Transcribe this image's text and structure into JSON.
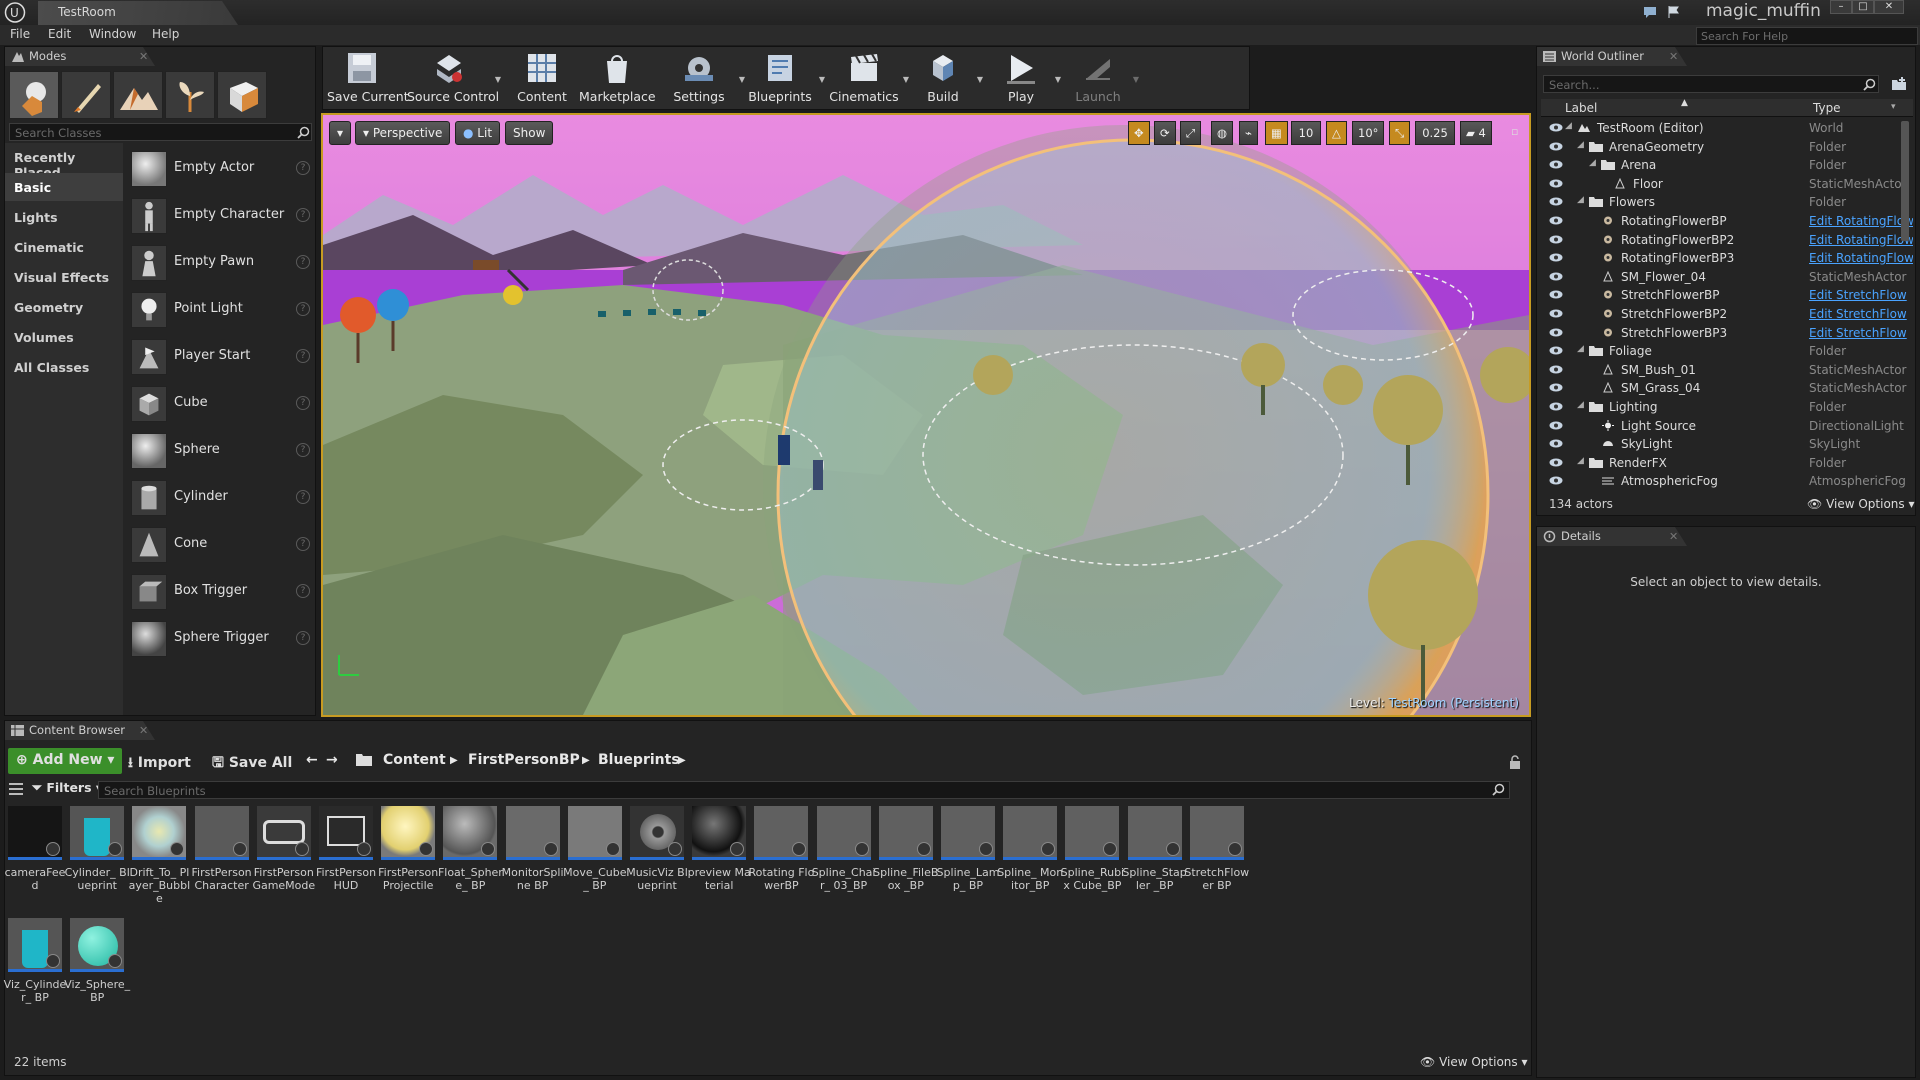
{
  "title_bar": {
    "tab": "TestRoom",
    "user": "magic_muffin"
  },
  "menu": [
    "File",
    "Edit",
    "Window",
    "Help"
  ],
  "help_search": {
    "placeholder": "Search For Help"
  },
  "modes": {
    "tab": "Modes",
    "search_placeholder": "Search Classes",
    "categories": [
      "Recently Placed",
      "Basic",
      "Lights",
      "Cinematic",
      "Visual Effects",
      "Geometry",
      "Volumes",
      "All Classes"
    ],
    "selected_category": "Basic",
    "items": [
      "Empty Actor",
      "Empty Character",
      "Empty Pawn",
      "Point Light",
      "Player Start",
      "Cube",
      "Sphere",
      "Cylinder",
      "Cone",
      "Box Trigger",
      "Sphere Trigger"
    ]
  },
  "toolbar": [
    "Save Current",
    "Source Control",
    "Content",
    "Marketplace",
    "Settings",
    "Blueprints",
    "Cinematics",
    "Build",
    "Play",
    "Launch"
  ],
  "viewport": {
    "perspective": "Perspective",
    "lit": "Lit",
    "show": "Show",
    "grid_snap": "10",
    "rotation_snap": "10°",
    "scale_snap": "0.25",
    "camera_speed": "4",
    "level_label": "Level:",
    "level_name": "TestRoom (Persistent)"
  },
  "outliner": {
    "tab": "World Outliner",
    "search_placeholder": "Search...",
    "col_label": "Label",
    "col_type": "Type",
    "rows": [
      {
        "label": "TestRoom (Editor)",
        "type": "World"
      },
      {
        "label": "ArenaGeometry",
        "type": "Folder"
      },
      {
        "label": "Arena",
        "type": "Folder"
      },
      {
        "label": "Floor",
        "type": "StaticMeshActor"
      },
      {
        "label": "Flowers",
        "type": "Folder"
      },
      {
        "label": "RotatingFlowerBP",
        "type": "Edit RotatingFlow"
      },
      {
        "label": "RotatingFlowerBP2",
        "type": "Edit RotatingFlow"
      },
      {
        "label": "RotatingFlowerBP3",
        "type": "Edit RotatingFlow"
      },
      {
        "label": "SM_Flower_04",
        "type": "StaticMeshActor"
      },
      {
        "label": "StretchFlowerBP",
        "type": "Edit StretchFlow"
      },
      {
        "label": "StretchFlowerBP2",
        "type": "Edit StretchFlow"
      },
      {
        "label": "StretchFlowerBP3",
        "type": "Edit StretchFlow"
      },
      {
        "label": "Foliage",
        "type": "Folder"
      },
      {
        "label": "SM_Bush_01",
        "type": "StaticMeshActor"
      },
      {
        "label": "SM_Grass_04",
        "type": "StaticMeshActor"
      },
      {
        "label": "Lighting",
        "type": "Folder"
      },
      {
        "label": "Light Source",
        "type": "DirectionalLight"
      },
      {
        "label": "SkyLight",
        "type": "SkyLight"
      },
      {
        "label": "RenderFX",
        "type": "Folder"
      },
      {
        "label": "AtmosphericFog",
        "type": "AtmosphericFog"
      }
    ],
    "actor_count": "134 actors",
    "view_options": "View Options"
  },
  "details": {
    "tab": "Details",
    "empty": "Select an object to view details."
  },
  "content_browser": {
    "tab": "Content Browser",
    "add_new": "Add New",
    "import": "Import",
    "save_all": "Save All",
    "path": [
      "Content",
      "FirstPersonBP",
      "Blueprints"
    ],
    "filters": "Filters",
    "search_placeholder": "Search Blueprints",
    "assets": [
      "cameraFeed",
      "Cylinder_ Blueprint",
      "Drift_To_ Player_Bubble",
      "FirstPerson Character",
      "FirstPerson GameMode",
      "FirstPerson HUD",
      "FirstPerson Projectile",
      "Float_Sphere_ BP",
      "MonitorSpline BP",
      "Move_Cube_ BP",
      "MusicViz Blueprint",
      "preview Material",
      "Rotating FlowerBP",
      "Spline_Chair_ 03_BP",
      "Spline_FileBox _BP",
      "Spline_Lamp_ BP",
      "Spline_ Monitor_BP",
      "Spline_Rubix Cube_BP",
      "Spline_Stapler _BP",
      "StretchFlower BP",
      "Viz_Cylinder_ BP",
      "Viz_Sphere_ BP"
    ],
    "item_count": "22 items",
    "view_options": "View Options"
  }
}
